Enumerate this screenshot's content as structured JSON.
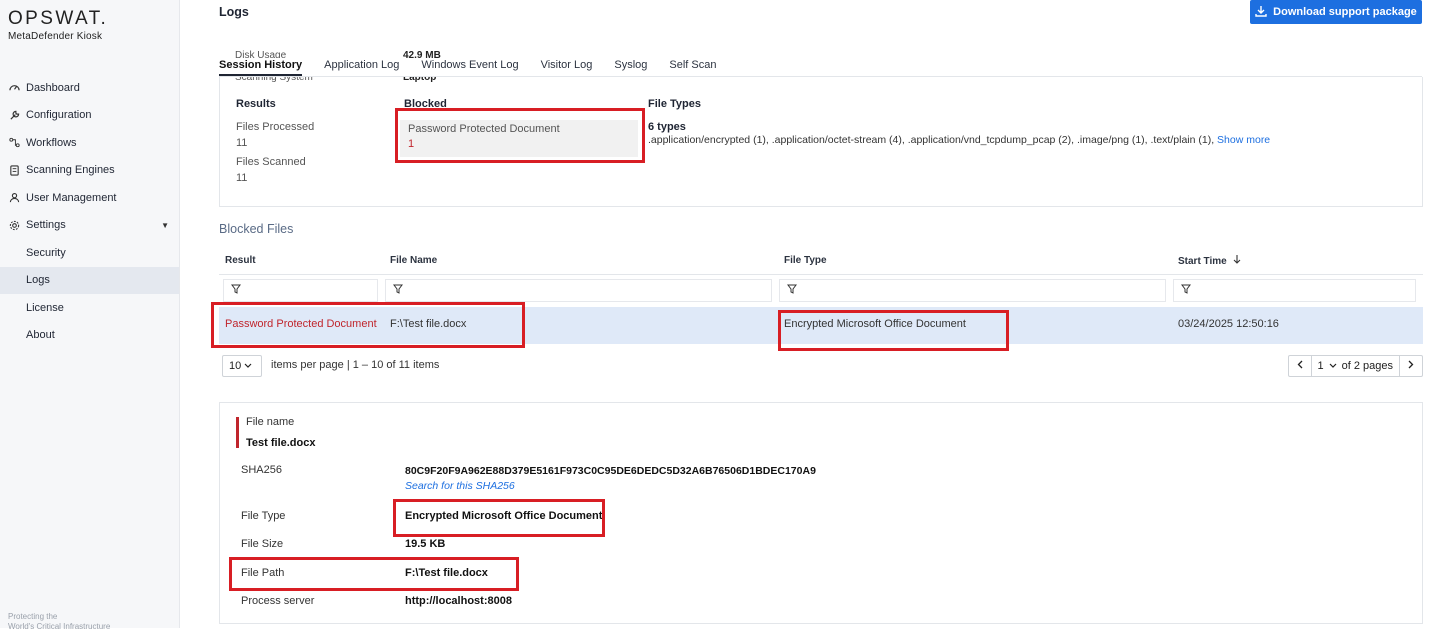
{
  "brand": {
    "logo": "OPSWAT.",
    "product": "MetaDefender Kiosk"
  },
  "sidebar": {
    "items": [
      {
        "label": "Dashboard",
        "icon": "dashboard-icon"
      },
      {
        "label": "Configuration",
        "icon": "wrench-icon"
      },
      {
        "label": "Workflows",
        "icon": "workflow-icon"
      },
      {
        "label": "Scanning Engines",
        "icon": "engine-icon"
      },
      {
        "label": "User Management",
        "icon": "users-icon"
      },
      {
        "label": "Settings",
        "icon": "gear-icon"
      }
    ],
    "sub_items": [
      "Security",
      "Logs",
      "License",
      "About"
    ],
    "footer_line1": "Protecting the",
    "footer_line2": "World's Critical Infrastructure"
  },
  "header": {
    "title": "Logs",
    "download_label": "Download support package"
  },
  "ghost": {
    "disk_label": "Disk Usage",
    "disk_value": "42.9 MB",
    "system_label": "Scanning System",
    "system_value": "Laptop"
  },
  "tabs": [
    "Session History",
    "Application Log",
    "Windows Event Log",
    "Visitor Log",
    "Syslog",
    "Self Scan"
  ],
  "summary": {
    "results_label": "Results",
    "files_processed_label": "Files Processed",
    "files_processed_value": "11",
    "files_scanned_label": "Files Scanned",
    "files_scanned_value": "11",
    "blocked_label": "Blocked",
    "blocked_reason": "Password Protected Document",
    "blocked_count": "1",
    "file_types_label": "File Types",
    "file_types_count": "6 types",
    "file_types_list": ".application/encrypted (1), .application/octet-stream (4), .application/vnd_tcpdump_pcap (2), .image/png (1), .text/plain (1),",
    "show_more": "Show more"
  },
  "blocked_files": {
    "title": "Blocked Files",
    "columns": [
      "Result",
      "File Name",
      "File Type",
      "Start Time"
    ],
    "rows": [
      {
        "result": "Password Protected Document",
        "file_name": "F:\\Test file.docx",
        "file_type": "Encrypted Microsoft Office Document",
        "start_time": "03/24/2025 12:50:16"
      }
    ]
  },
  "pager": {
    "page_size": "10",
    "items_text": "items per page | 1 – 10 of 11 items",
    "page": "1",
    "of_pages": "of 2 pages"
  },
  "detail": {
    "file_name_label": "File name",
    "file_name_value": "Test file.docx",
    "sha256_label": "SHA256",
    "sha256_value": "80C9F20F9A962E88D379E5161F973C0C95DE6DEDC5D32A6B76506D1BDEC170A9",
    "sha256_link": "Search for this SHA256",
    "file_type_label": "File Type",
    "file_type_value": "Encrypted Microsoft Office Document",
    "file_size_label": "File Size",
    "file_size_value": "19.5 KB",
    "file_path_label": "File Path",
    "file_path_value": "F:\\Test file.docx",
    "process_server_label": "Process server",
    "process_server_value": "http://localhost:8008"
  },
  "colors": {
    "accent_blue": "#1d6fe0",
    "highlight_red": "#d81e24",
    "blocked_red": "#c0252c",
    "row_selected": "#dfe9f8"
  }
}
